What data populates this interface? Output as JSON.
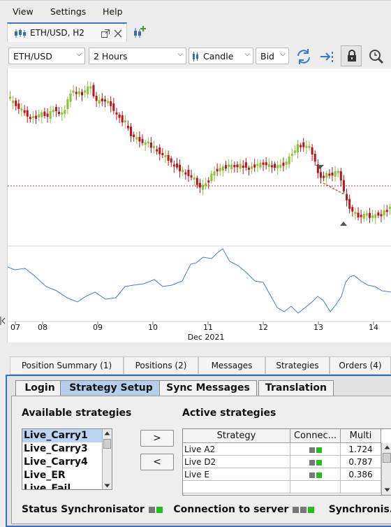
{
  "menu": {
    "items": [
      "View",
      "Settings",
      "Help"
    ]
  },
  "doc_tab": {
    "label": "ETH/USD, H2"
  },
  "toolbar": {
    "instrument": "ETH/USD",
    "period": "2 Hours",
    "chart_type": "Candle",
    "side": "Bid",
    "icons": [
      "refresh-icon",
      "auto-shift-icon",
      "lock-icon",
      "zoom-icon"
    ]
  },
  "chart_data": {
    "type": "candlestick",
    "x_ticks": [
      "07",
      "08",
      "09",
      "10",
      "11",
      "12",
      "13",
      "14"
    ],
    "x_month_label": "Dec 2021",
    "colors": {
      "up": "#8bbf3c",
      "down": "#b8141c",
      "indicator": "#4a7bc4",
      "price_line": "#cc2a2a"
    }
  },
  "bottom_tabs": [
    "Position Summary (1)",
    "Positions (2)",
    "Messages",
    "Strategies",
    "Orders (4)"
  ],
  "sub_tabs": [
    "Login",
    "Strategy Setup",
    "Sync Messages",
    "Translation"
  ],
  "available": {
    "title": "Available strategies",
    "items": [
      "Live_Carry1",
      "Live_Carry3",
      "Live_Carry4",
      "Live_ER",
      "Live_Fail"
    ]
  },
  "buttons": {
    "add": ">",
    "remove": "<"
  },
  "active": {
    "title": "Active strategies",
    "columns": [
      "Strategy",
      "Connec...",
      "Multi"
    ],
    "rows": [
      {
        "strategy": "Live A2",
        "multi": "1.724"
      },
      {
        "strategy": "Live D2",
        "multi": "0.787"
      },
      {
        "strategy": "Live E",
        "multi": "0.386"
      }
    ]
  },
  "status": {
    "sync_label": "Status Synchronisator",
    "server_label": "Connection to server",
    "trailing_label": "Synchronis..."
  }
}
